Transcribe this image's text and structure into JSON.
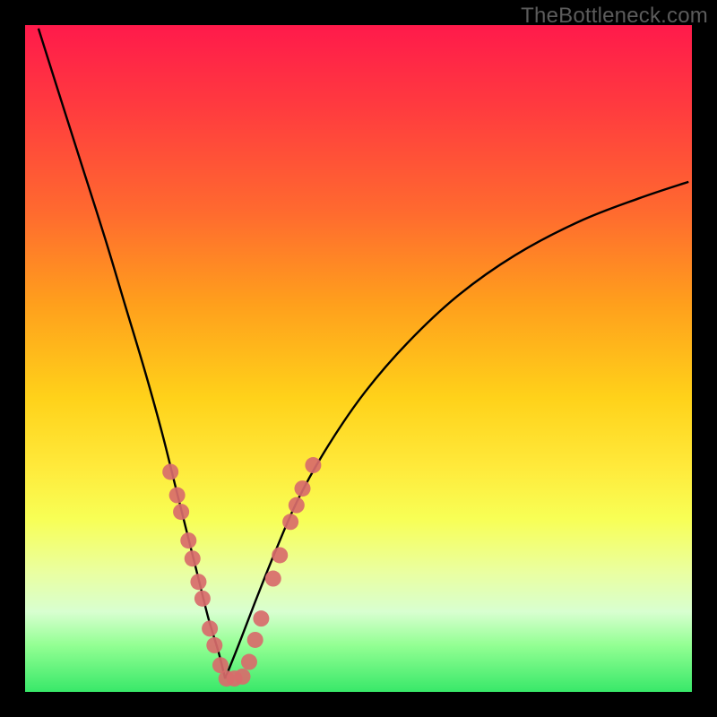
{
  "watermark": "TheBottleneck.com",
  "colors": {
    "frame_bg": "#000000",
    "curve_stroke": "#000000",
    "dot_fill": "#d86b6b",
    "dot_stroke": "#a04646"
  },
  "chart_data": {
    "type": "line",
    "title": "",
    "xlabel": "",
    "ylabel": "",
    "xlim": [
      0,
      1
    ],
    "ylim": [
      0,
      1
    ],
    "note": "No numeric axes or tick labels are rendered in the image; values are normalized estimates in [0,1] read from pixel positions.",
    "series": [
      {
        "name": "curve-left",
        "x": [
          0.02,
          0.05,
          0.085,
          0.12,
          0.15,
          0.18,
          0.205,
          0.225,
          0.245,
          0.26,
          0.275,
          0.29,
          0.3
        ],
        "y": [
          0.995,
          0.9,
          0.79,
          0.68,
          0.58,
          0.48,
          0.39,
          0.31,
          0.23,
          0.17,
          0.11,
          0.06,
          0.02
        ]
      },
      {
        "name": "curve-right",
        "x": [
          0.3,
          0.32,
          0.345,
          0.375,
          0.41,
          0.455,
          0.51,
          0.575,
          0.65,
          0.735,
          0.83,
          0.92,
          0.995
        ],
        "y": [
          0.02,
          0.07,
          0.135,
          0.21,
          0.29,
          0.37,
          0.45,
          0.525,
          0.595,
          0.655,
          0.705,
          0.74,
          0.765
        ]
      }
    ],
    "dots": [
      {
        "x": 0.218,
        "y": 0.33
      },
      {
        "x": 0.228,
        "y": 0.295
      },
      {
        "x": 0.234,
        "y": 0.27
      },
      {
        "x": 0.245,
        "y": 0.227
      },
      {
        "x": 0.251,
        "y": 0.2
      },
      {
        "x": 0.26,
        "y": 0.165
      },
      {
        "x": 0.266,
        "y": 0.14
      },
      {
        "x": 0.277,
        "y": 0.095
      },
      {
        "x": 0.284,
        "y": 0.07
      },
      {
        "x": 0.293,
        "y": 0.04
      },
      {
        "x": 0.302,
        "y": 0.02
      },
      {
        "x": 0.314,
        "y": 0.02
      },
      {
        "x": 0.326,
        "y": 0.023
      },
      {
        "x": 0.336,
        "y": 0.045
      },
      {
        "x": 0.345,
        "y": 0.078
      },
      {
        "x": 0.354,
        "y": 0.11
      },
      {
        "x": 0.372,
        "y": 0.17
      },
      {
        "x": 0.382,
        "y": 0.205
      },
      {
        "x": 0.398,
        "y": 0.255
      },
      {
        "x": 0.407,
        "y": 0.28
      },
      {
        "x": 0.416,
        "y": 0.305
      },
      {
        "x": 0.432,
        "y": 0.34
      }
    ]
  }
}
